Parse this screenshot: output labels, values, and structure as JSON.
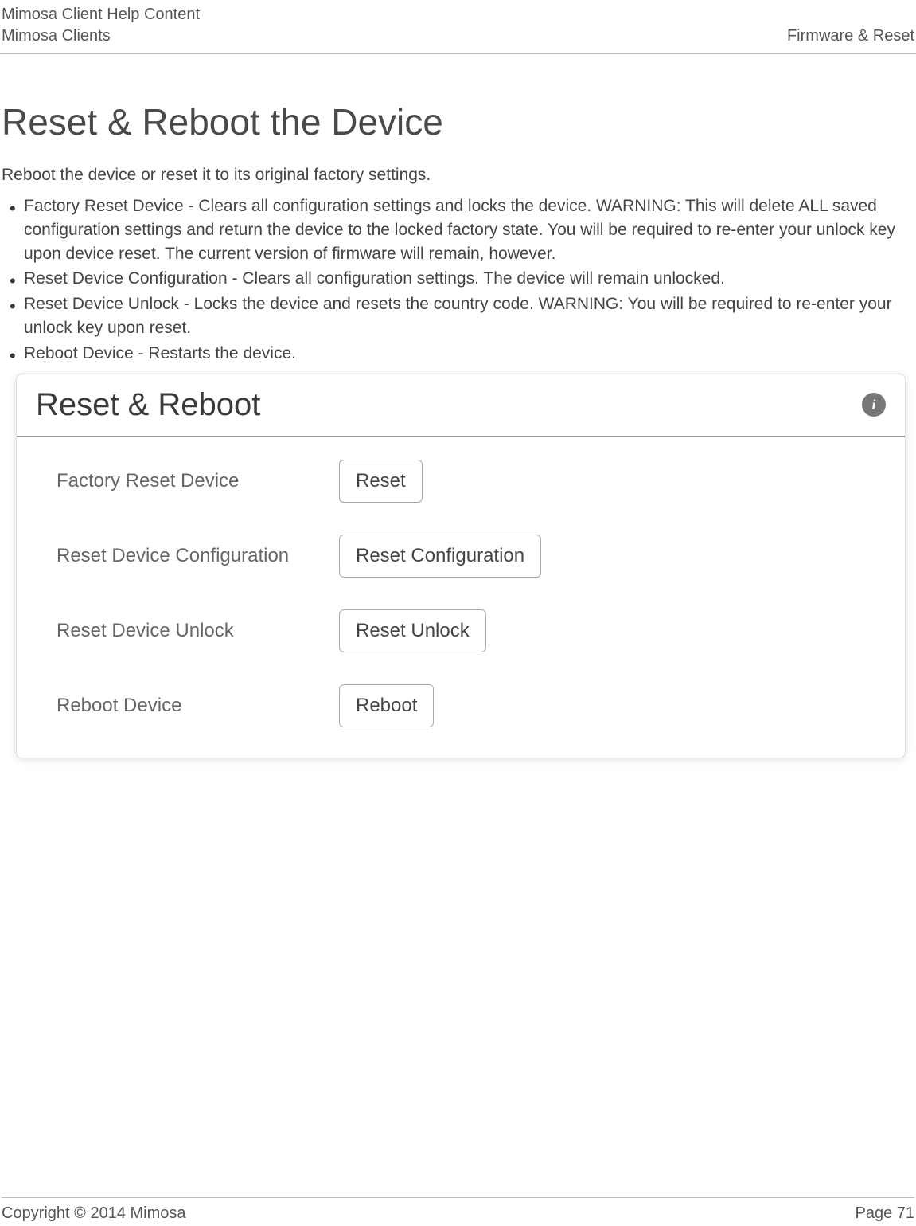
{
  "header": {
    "line1": "Mimosa Client Help Content",
    "line2": "Mimosa Clients",
    "right": "Firmware & Reset"
  },
  "page_title": "Reset & Reboot the Device",
  "intro": "Reboot the device or reset it to its original factory settings.",
  "bullets": [
    "Factory Reset Device - Clears all configuration settings and locks the device. WARNING: This will delete ALL saved configuration settings and return the device to the locked factory state. You will be required to re-enter your unlock key upon device reset. The current version of firmware will remain, however.",
    "Reset Device Configuration - Clears all configuration settings. The device will remain unlocked.",
    "Reset Device Unlock - Locks the device and resets the country code. WARNING: You will be required to re-enter your unlock key upon reset.",
    "Reboot Device - Restarts the device."
  ],
  "panel": {
    "title": "Reset & Reboot",
    "info_glyph": "i",
    "rows": {
      "factory_reset": {
        "label": "Factory Reset Device",
        "button": "Reset"
      },
      "reset_config": {
        "label": "Reset Device Configuration",
        "button": "Reset Configuration"
      },
      "reset_unlock": {
        "label": "Reset Device Unlock",
        "button": "Reset Unlock"
      },
      "reboot": {
        "label": "Reboot Device",
        "button": "Reboot"
      }
    }
  },
  "footer": {
    "copyright": "Copyright © 2014 Mimosa",
    "page_num": "Page 71"
  }
}
